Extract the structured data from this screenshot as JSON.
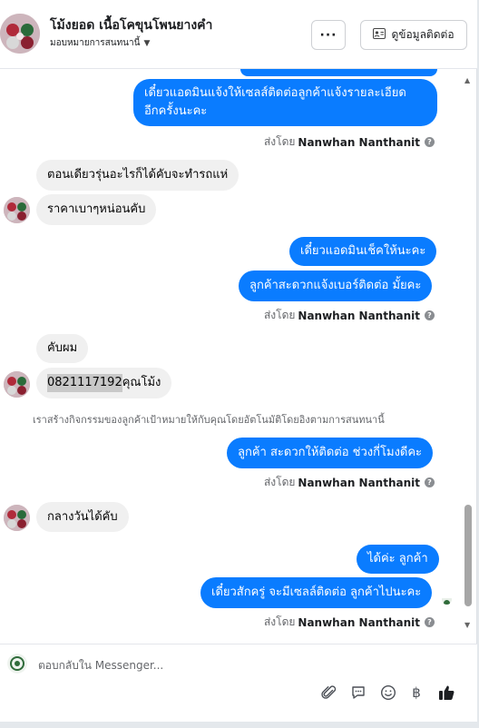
{
  "header": {
    "contact_name": "โม้งยอด เนื้อโคขุนโพนยางคำ",
    "assign_label": "มอบหมายการสนทนานี้",
    "more_label": "···",
    "view_contact_label": "ดูข้อมูลติดต่อ"
  },
  "messages": {
    "out_1": "เดี๋ยวแอดมินแจ้งให้เซลส์ติดต่อลูกค้าแจ้งรายละเอียด",
    "out_1b": "อีกครั้งนะคะ",
    "sent_prefix": "ส่งโดย",
    "sender": "Nanwhan Nanthanit",
    "in_1": "ตอนเดียวรุ่นอะไรก็ได้คับจะทำรถแห่",
    "in_2": "ราคาเบาๆหน่อนคับ",
    "out_2": "เดี๋ยวแอดมินเช็คให้นะคะ",
    "out_3": "ลูกค้าสะดวกแจ้งเบอร์ติดต่อ มั้ยคะ",
    "in_3": "คับผม",
    "in_4_phone": "0821117192",
    "in_4_rest": "คุณโม้ง",
    "system_note": "เราสร้างกิจกรรมของลูกค้าเป้าหมายให้กับคุณโดยอัตโนมัติโดยอิงตามการสนทนานี้",
    "out_4": "ลูกค้า สะดวกให้ติดต่อ ช่วงกี่โมงดีคะ",
    "in_5": "กลางวันได้คับ",
    "out_5": "ได้ค่ะ ลูกค้า",
    "out_6": "เดี๋ยวสักครู่ จะมีเซลล์ติดต่อ ลูกค้าไปนะคะ"
  },
  "composer": {
    "placeholder": "ตอบกลับใน Messenger..."
  },
  "colors": {
    "outgoing": "#0a7cff",
    "incoming": "#f0f0f0",
    "like": "#1c1e21"
  },
  "icons": [
    "avatar",
    "chevron-down-icon",
    "more-icon",
    "contact-card-icon",
    "help-icon",
    "attach-icon",
    "saved-reply-icon",
    "emoji-icon",
    "baht-icon",
    "like-icon"
  ]
}
